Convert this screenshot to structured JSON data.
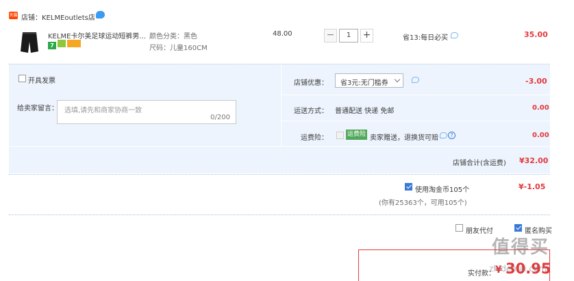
{
  "shop": {
    "badge": "天猫",
    "label": "店铺：KELMEoutlets店"
  },
  "item": {
    "title": "KELME卡尔美足球运动短裤男...",
    "color": "颜色分类：黑色",
    "size": "尺码：儿童160CM",
    "unit_price": "48.00",
    "quantity": "1",
    "minus_label": "−",
    "plus_label": "+",
    "promo": "省13:每日必买",
    "subtotal": "35.00",
    "tags": [
      {
        "label": "7",
        "color": "#2aa84a"
      },
      {
        "label": "",
        "color": "#8fc63d"
      },
      {
        "label": "",
        "color": "#f5a623"
      }
    ]
  },
  "invoice": {
    "label": "开具发票"
  },
  "message": {
    "label": "给卖家留言：",
    "placeholder": "选填,请先和商家协商一致",
    "counter": "0/200"
  },
  "shop_discount": {
    "label": "店铺优惠：",
    "selected": "省3元:无门槛券",
    "amount": "-3.00"
  },
  "shipping": {
    "label": "运送方式：",
    "value": "普通配送 快递 免邮",
    "amount": "0.00"
  },
  "insurance": {
    "label": "运费险：",
    "badge": "运费险",
    "value": "卖家赠送，退换货可赔",
    "help": "?",
    "amount": "0.00"
  },
  "shop_total": {
    "label": "店铺合计(含运费)",
    "amount": "¥32.00"
  },
  "coins": {
    "label": "使用淘金币105个",
    "note": "(你有25363个，可用105个)",
    "amount": "¥-1.05"
  },
  "options": {
    "friend_pay": "朋友代付",
    "anonymous": "匿名购买"
  },
  "actual_pay": {
    "label": "实付款：",
    "currency": "¥",
    "amount": "30.95"
  },
  "watermark": {
    "text": "值得买",
    "url": "zhidemai.com"
  },
  "colors": {
    "price_red": "#e4393c",
    "row_bg": "#edf4fd",
    "checkbox_blue": "#3a7ad6",
    "insurance_green": "#52a85a"
  }
}
